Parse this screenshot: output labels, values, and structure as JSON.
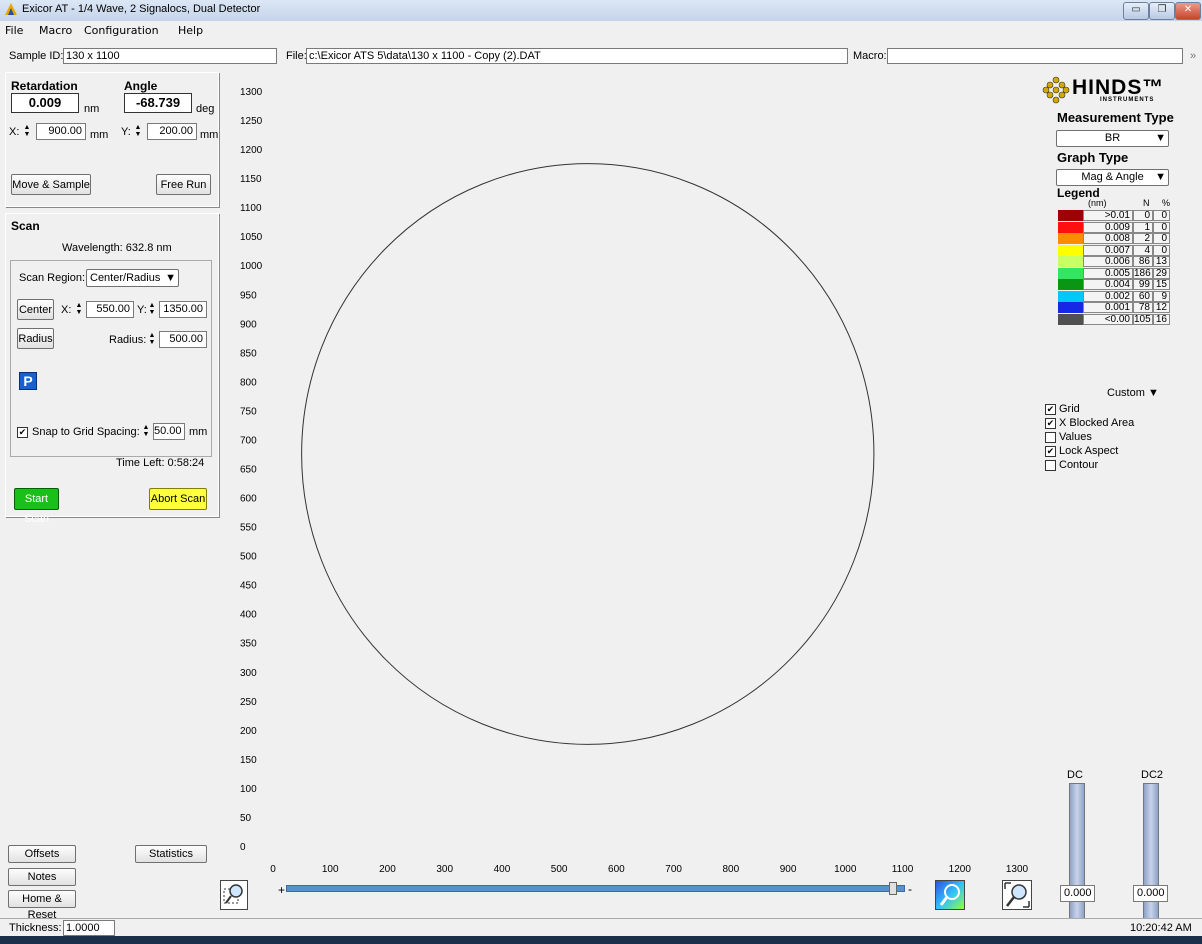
{
  "window": {
    "title": "Exicor AT - 1/4 Wave, 2 Signalocs, Dual Detector",
    "minimize": "▭",
    "maximize": "❐",
    "close": "✕"
  },
  "menu": [
    "File",
    "Macro",
    "Configuration",
    "Help"
  ],
  "info": {
    "sample_label": "Sample ID:",
    "sample_value": "130 x 1100",
    "file_label": "File:",
    "file_value": "c:\\Exicor ATS 5\\data\\130 x 1100 - Copy (2).DAT",
    "macro_label": "Macro:",
    "macro_value": "",
    "expand": "»"
  },
  "measure": {
    "retardation_label": "Retardation",
    "retardation_value": "0.009",
    "retardation_unit": "nm",
    "angle_label": "Angle",
    "angle_value": "-68.739",
    "angle_unit": "deg",
    "x_label": "X:",
    "x_value": "900.00",
    "x_unit": "mm",
    "y_label": "Y:",
    "y_value": "200.00",
    "y_unit": "mm",
    "move_sample": "Move & Sample",
    "free_run": "Free Run"
  },
  "scan": {
    "title": "Scan",
    "wavelength": "Wavelength: 632.8 nm",
    "region_label": "Scan Region:",
    "region_value": "Center/Radius",
    "center_btn": "Center",
    "cx_label": "X:",
    "cx_value": "550.00",
    "cy_label": "Y:",
    "cy_value": "1350.00",
    "radius_btn": "Radius",
    "radius_label": "Radius:",
    "radius_value": "500.00",
    "p_icon": "P",
    "snap_label": "Snap to Grid Spacing:",
    "snap_value": "50.00",
    "snap_unit": "mm",
    "time_left": "Time Left:  0:58:24",
    "start": "Start Scan",
    "abort": "Abort Scan"
  },
  "bottom_left": {
    "offsets": "Offsets",
    "statistics": "Statistics",
    "notes": "Notes",
    "home_reset": "Home & Reset"
  },
  "right_panel": {
    "logo": "HINDS™",
    "logo_sub": "INSTRUMENTS",
    "measurement_type_label": "Measurement Type",
    "measurement_type_value": "BR",
    "graph_type_label": "Graph Type",
    "graph_type_value": "Mag & Angle",
    "legend_label": "Legend",
    "legend_unit": "(nm)",
    "legend_n": "N",
    "legend_pct": "%",
    "legend": [
      {
        "label": ">0.01",
        "n": "0",
        "pct": "0",
        "color": "#a00000"
      },
      {
        "label": "0.009",
        "n": "1",
        "pct": "0",
        "color": "#ff1010"
      },
      {
        "label": "0.008",
        "n": "2",
        "pct": "0",
        "color": "#ff8c00"
      },
      {
        "label": "0.007",
        "n": "4",
        "pct": "0",
        "color": "#ffff00"
      },
      {
        "label": "0.006",
        "n": "86",
        "pct": "13",
        "color": "#c8ff64"
      },
      {
        "label": "0.005",
        "n": "186",
        "pct": "29",
        "color": "#32e664"
      },
      {
        "label": "0.004",
        "n": "99",
        "pct": "15",
        "color": "#0a9614"
      },
      {
        "label": "0.002",
        "n": "60",
        "pct": "9",
        "color": "#00c8ff"
      },
      {
        "label": "0.001",
        "n": "78",
        "pct": "12",
        "color": "#1428e6"
      },
      {
        "label": "<0.00",
        "n": "105",
        "pct": "16",
        "color": "#505050"
      }
    ],
    "custom": "Custom",
    "checks": [
      {
        "label": "Grid",
        "checked": "✔"
      },
      {
        "label": "X Blocked Area",
        "checked": "✔"
      },
      {
        "label": "Values",
        "checked": ""
      },
      {
        "label": "Lock Aspect",
        "checked": "✔"
      },
      {
        "label": "Contour",
        "checked": ""
      }
    ],
    "dc_label": "DC",
    "dc2_label": "DC2",
    "dc_value": "0.000",
    "dc2_value": "0.000"
  },
  "status": {
    "thickness_label": "Thickness:",
    "thickness_value": "1.0000",
    "time": "10:20:42 AM"
  },
  "zoom": {
    "plus": "+",
    "minus": "-",
    "level": 0.98
  },
  "chart_data": {
    "type": "scatter",
    "xlim": [
      0,
      1300
    ],
    "ylim": [
      0,
      1300
    ],
    "x_ticks": [
      0,
      100,
      200,
      300,
      400,
      500,
      600,
      700,
      800,
      900,
      1000,
      1100,
      1200,
      1300
    ],
    "y_ticks": [
      0,
      50,
      100,
      150,
      200,
      250,
      300,
      350,
      400,
      450,
      500,
      550,
      600,
      650,
      700,
      750,
      800,
      850,
      900,
      950,
      1000,
      1050,
      1100,
      1150,
      1200,
      1250,
      1300
    ],
    "scan_circle": {
      "cx": 550,
      "cy": 675,
      "r": 500
    },
    "grid": false
  }
}
